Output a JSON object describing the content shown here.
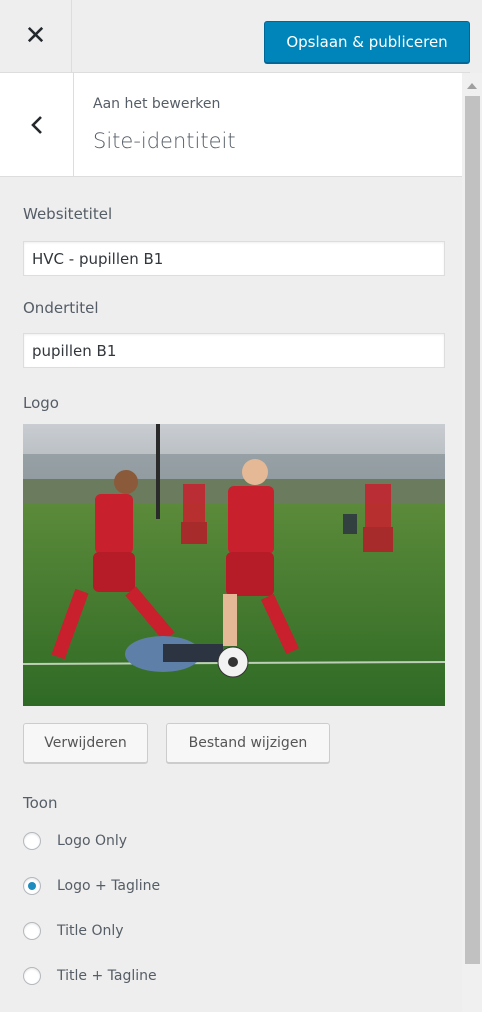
{
  "header": {
    "close_icon": "close-icon",
    "publish_label": "Opslaan & publiceren",
    "publish_color": "#0085ba"
  },
  "section": {
    "back_icon": "chevron-left-icon",
    "breadcrumb": "Aan het bewerken",
    "title": "Site-identiteit"
  },
  "form": {
    "site_title_label": "Websitetitel",
    "site_title_value": "HVC - pupillen B1",
    "tagline_label": "Ondertitel",
    "tagline_value": "pupillen B1",
    "logo_label": "Logo",
    "logo_image": "youth soccer players on field photo",
    "remove_label": "Verwijderen",
    "change_label": "Bestand wijzigen",
    "display_label": "Toon",
    "display_options": [
      {
        "label": "Logo Only",
        "checked": false
      },
      {
        "label": "Logo + Tagline",
        "checked": true
      },
      {
        "label": "Title Only",
        "checked": false
      },
      {
        "label": "Title + Tagline",
        "checked": false
      }
    ]
  }
}
